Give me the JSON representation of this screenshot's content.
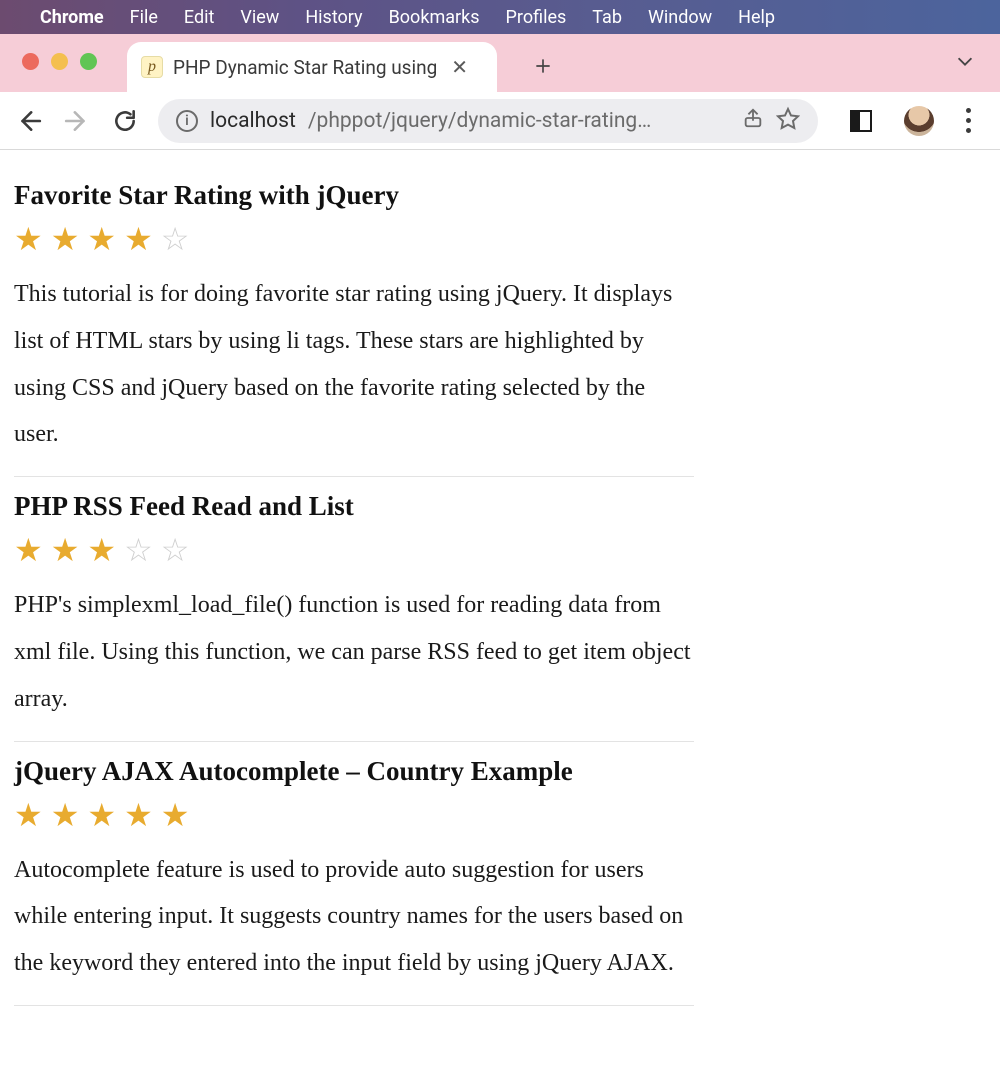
{
  "menubar": {
    "app": "Chrome",
    "items": [
      "File",
      "Edit",
      "View",
      "History",
      "Bookmarks",
      "Profiles",
      "Tab",
      "Window",
      "Help"
    ]
  },
  "tab": {
    "title": "PHP Dynamic Star Rating using",
    "favicon_letter": "p"
  },
  "omnibox": {
    "host": "localhost",
    "path": "/phppot/jquery/dynamic-star-rating…"
  },
  "colors": {
    "star_filled": "#e8ab2f",
    "star_empty": "#cfcfcf"
  },
  "articles": [
    {
      "title": "Favorite Star Rating with jQuery",
      "rating": 4,
      "max_rating": 5,
      "description": "This tutorial is for doing favorite star rating using jQuery. It displays list of HTML stars by using li tags. These stars are highlighted by using CSS and jQuery based on the favorite rating selected by the user."
    },
    {
      "title": "PHP RSS Feed Read and List",
      "rating": 3,
      "max_rating": 5,
      "description": "PHP's simplexml_load_file() function is used for reading data from xml file. Using this function, we can parse RSS feed to get item object array."
    },
    {
      "title": "jQuery AJAX Autocomplete – Country Example",
      "rating": 5,
      "max_rating": 5,
      "description": "Autocomplete feature is used to provide auto suggestion for users while entering input. It suggests country names for the users based on the keyword they entered into the input field by using jQuery AJAX."
    }
  ]
}
